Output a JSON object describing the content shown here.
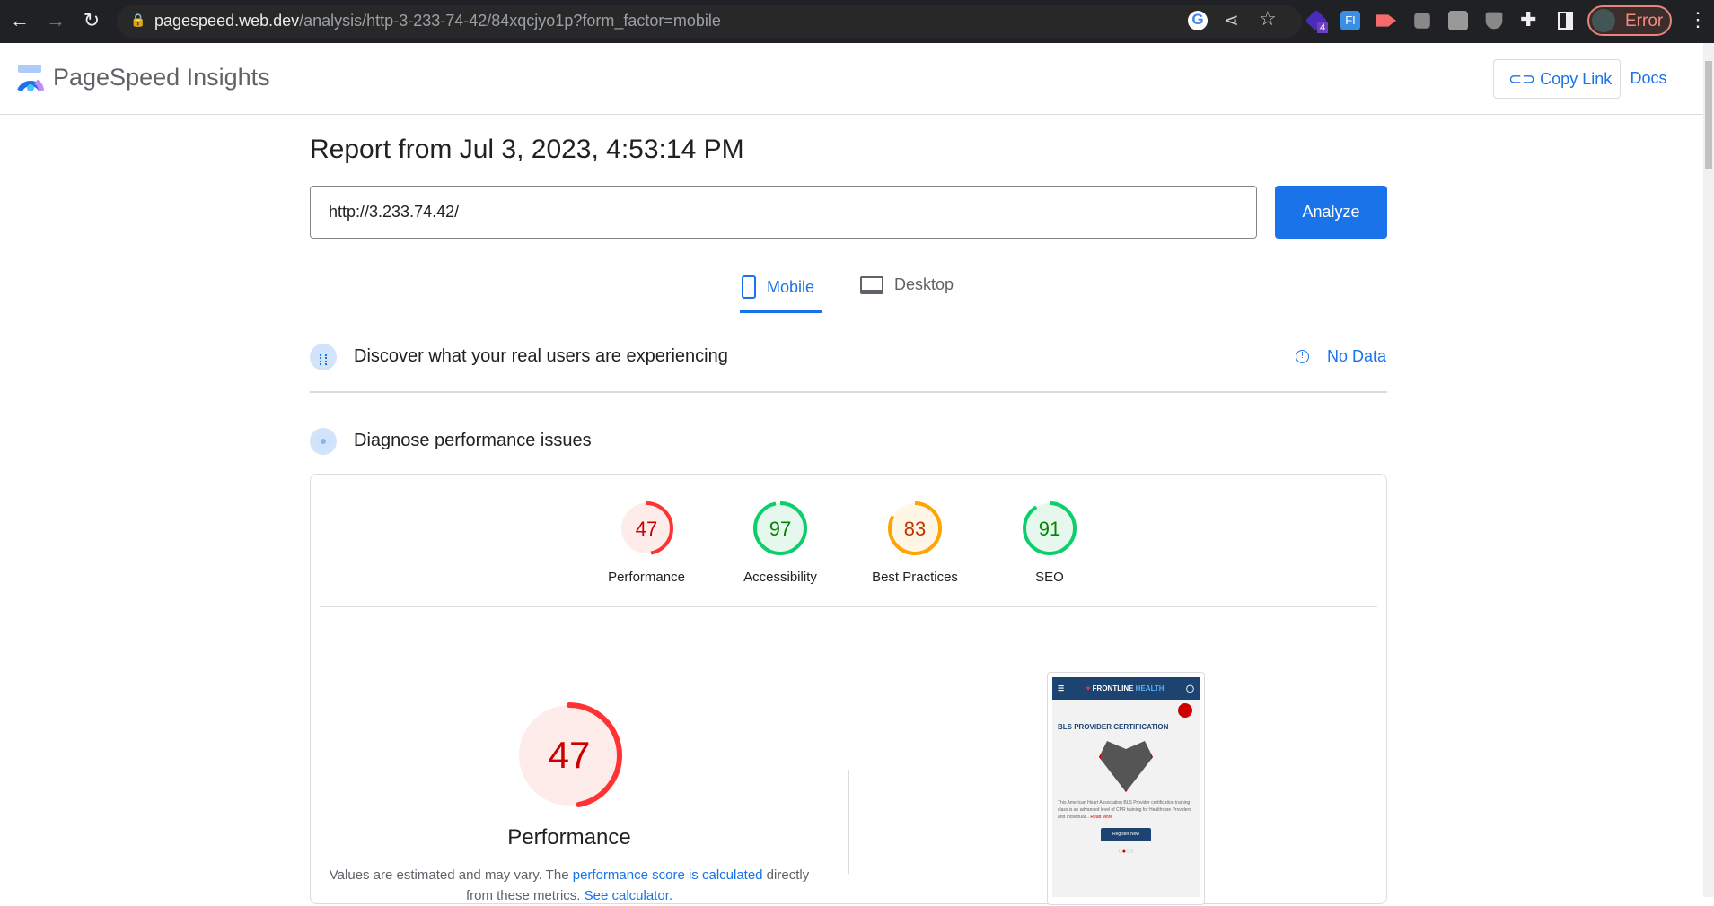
{
  "browser": {
    "url_host": "pagespeed.web.dev",
    "url_path": "/analysis/http-3-233-74-42/84xqcjyo1p?form_factor=mobile",
    "extension_badge": "4",
    "ext_fi": "FI",
    "profile_label": "Error"
  },
  "header": {
    "title": "PageSpeed Insights",
    "copy_link": "Copy Link",
    "docs": "Docs"
  },
  "report": {
    "title": "Report from Jul 3, 2023, 4:53:14 PM",
    "url_value": "http://3.233.74.42/",
    "analyze": "Analyze"
  },
  "tabs": [
    {
      "label": "Mobile",
      "active": true
    },
    {
      "label": "Desktop",
      "active": false
    }
  ],
  "field": {
    "title": "Discover what your real users are experiencing",
    "status": "No Data"
  },
  "lab": {
    "title": "Diagnose performance issues"
  },
  "scores": [
    {
      "label": "Performance",
      "value": 47,
      "color": "#ff3333",
      "bg": "#fdecea",
      "text": "#c00"
    },
    {
      "label": "Accessibility",
      "value": 97,
      "color": "#0cce6b",
      "bg": "#e6f7ee",
      "text": "#080"
    },
    {
      "label": "Best Practices",
      "value": 83,
      "color": "#ffa400",
      "bg": "#fff6e6",
      "text": "#c33300"
    },
    {
      "label": "SEO",
      "value": 91,
      "color": "#0cce6b",
      "bg": "#e6f7ee",
      "text": "#080"
    }
  ],
  "main_score": {
    "label": "Performance",
    "value": 47,
    "desc_prefix": "Values are estimated and may vary. The ",
    "link1": "performance score is calculated",
    "desc_mid": " directly from these metrics. ",
    "link2": "See calculator."
  },
  "screenshot": {
    "brand": "FRONTLINE",
    "brand2": "HEALTH",
    "heading": "BLS PROVIDER CERTIFICATION",
    "body": "This American Heart Association BLS Provider certification training class is an advanced level of CPR training for Healthcare Providers and Individual...",
    "read_more": "Read More",
    "button": "Register Now"
  }
}
